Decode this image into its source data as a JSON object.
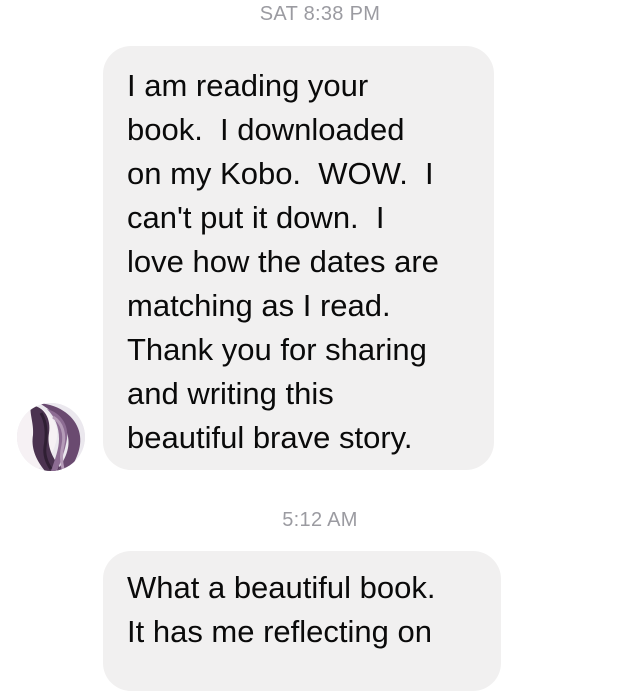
{
  "conversation": {
    "timestamp_1": "SAT 8:38 PM",
    "message_1": "I am reading your\nbook.  I downloaded\non my Kobo.  WOW.  I\ncan't put it down.  I\nlove how the dates are\nmatching as I read.\nThank you for sharing\nand writing this\nbeautiful brave story.",
    "timestamp_2": "5:12 AM",
    "message_2": "What a beautiful book.\nIt has me reflecting on"
  },
  "colors": {
    "bubble": "#f1f0f0",
    "timestamp": "#9b9ba1",
    "text": "#0a0a0a"
  }
}
